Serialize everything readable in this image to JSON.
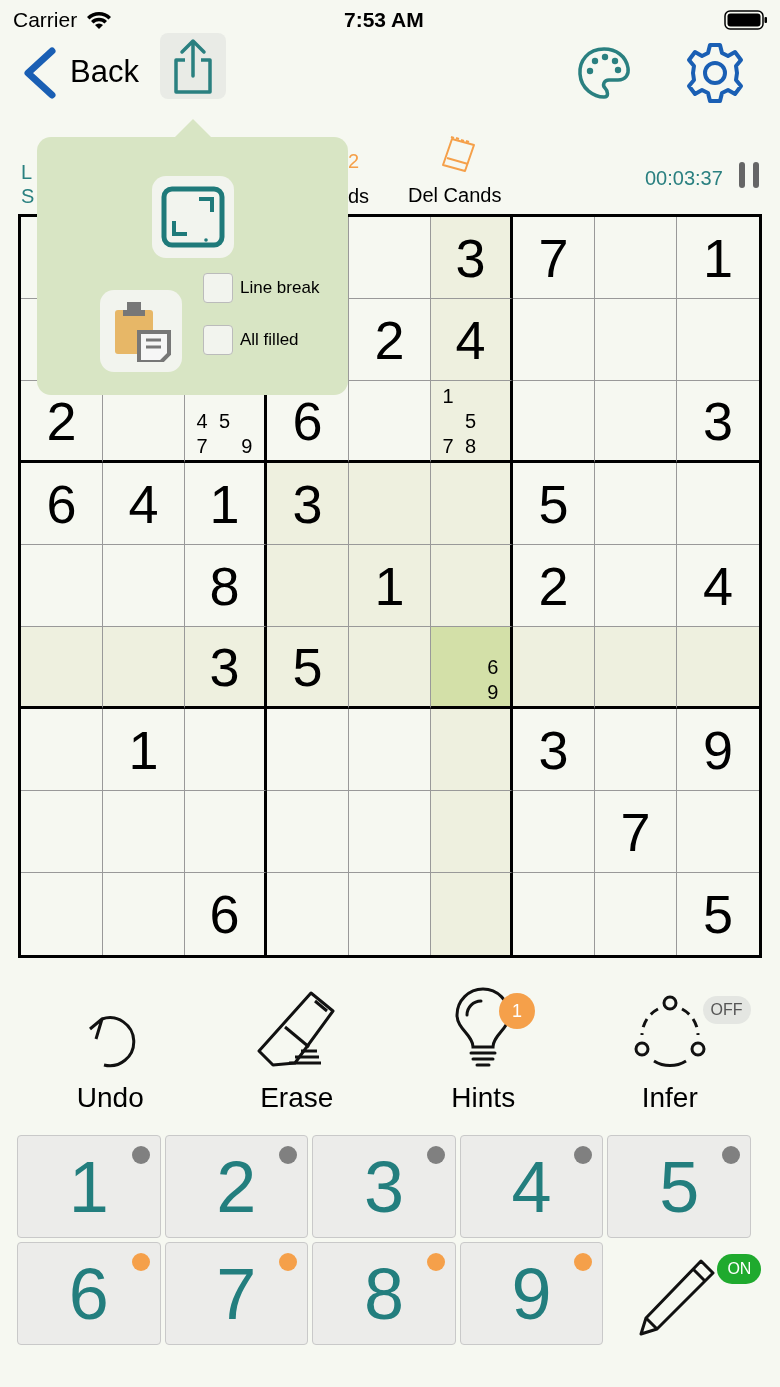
{
  "status_bar": {
    "carrier": "Carrier",
    "time": "7:53 AM"
  },
  "nav": {
    "back": "Back"
  },
  "info": {
    "level_partial": "L",
    "score_partial": "S",
    "count_partial": "2",
    "cands_partial": "ds",
    "del_cands": "Del Cands",
    "timer": "00:03:37"
  },
  "popover": {
    "options": [
      {
        "label": "Line break",
        "checked": false
      },
      {
        "label": "All filled",
        "checked": false
      }
    ]
  },
  "grid": {
    "rows": [
      [
        {
          "selected": false
        },
        null,
        null,
        null,
        {
          "selected": false
        },
        {
          "value": "3",
          "selected": false
        },
        {
          "value": "7",
          "selected": false
        },
        {
          "selected": false
        },
        {
          "value": "1",
          "selected": false
        }
      ],
      [
        {
          "selected": false
        },
        null,
        null,
        null,
        {
          "value": "2",
          "selected": false
        },
        {
          "value": "4",
          "selected": false
        },
        {
          "selected": false
        },
        {
          "selected": false
        },
        {
          "selected": false
        }
      ],
      [
        {
          "value": "2",
          "selected": false
        },
        {
          "selected": false
        },
        {
          "candidates": [
            "4",
            "5",
            "7",
            "9"
          ],
          "selected": false
        },
        {
          "value": "6",
          "selected": false
        },
        {
          "selected": false
        },
        {
          "candidates": [
            "1",
            "5",
            "7",
            "8"
          ],
          "selected": false
        },
        {
          "selected": false
        },
        {
          "selected": false
        },
        {
          "value": "3",
          "selected": false
        }
      ],
      [
        {
          "value": "6",
          "selected": false
        },
        {
          "value": "4",
          "selected": false
        },
        {
          "value": "1",
          "selected": false
        },
        {
          "value": "3",
          "selected": false
        },
        {
          "selected": false
        },
        {
          "selected": false
        },
        {
          "value": "5",
          "selected": false
        },
        {
          "selected": false
        },
        {
          "selected": false
        }
      ],
      [
        {
          "selected": false
        },
        {
          "selected": false
        },
        {
          "value": "8",
          "selected": false
        },
        {
          "selected": false
        },
        {
          "value": "1",
          "selected": false
        },
        {
          "selected": false
        },
        {
          "value": "2",
          "selected": false
        },
        {
          "selected": false
        },
        {
          "value": "4",
          "selected": false
        }
      ],
      [
        {
          "selected": false
        },
        {
          "selected": false
        },
        {
          "value": "3",
          "selected": false
        },
        {
          "value": "5",
          "selected": false
        },
        {
          "selected": false
        },
        {
          "candidates": [
            "6",
            "9"
          ],
          "selected": true
        },
        {
          "selected": false
        },
        {
          "selected": false
        },
        {
          "selected": false
        }
      ],
      [
        {
          "selected": false
        },
        {
          "value": "1",
          "selected": false
        },
        {
          "selected": false
        },
        {
          "selected": false
        },
        {
          "selected": false
        },
        {
          "selected": false
        },
        {
          "value": "3",
          "selected": false
        },
        {
          "selected": false
        },
        {
          "value": "9",
          "selected": false
        }
      ],
      [
        {
          "selected": false
        },
        {
          "selected": false
        },
        {
          "selected": false
        },
        {
          "selected": false
        },
        {
          "selected": false
        },
        {
          "selected": false
        },
        {
          "selected": false
        },
        {
          "value": "7",
          "selected": false
        },
        {
          "selected": false
        }
      ],
      [
        {
          "selected": false
        },
        {
          "selected": false
        },
        {
          "value": "6",
          "selected": false
        },
        {
          "selected": false
        },
        {
          "selected": false
        },
        {
          "selected": false
        },
        {
          "selected": false
        },
        {
          "selected": false
        },
        {
          "value": "5",
          "selected": false
        }
      ]
    ]
  },
  "tools": [
    {
      "kind": "undo",
      "label": "Undo"
    },
    {
      "kind": "erase",
      "label": "Erase"
    },
    {
      "kind": "hints",
      "label": "Hints",
      "badge": "1"
    },
    {
      "kind": "infer",
      "label": "Infer",
      "toggle": "OFF",
      "on": false
    }
  ],
  "number_pad": [
    {
      "digit": "1",
      "color": "#808080"
    },
    {
      "digit": "2",
      "color": "#808080"
    },
    {
      "digit": "3",
      "color": "#808080"
    },
    {
      "digit": "4",
      "color": "#808080"
    },
    {
      "digit": "5",
      "color": "#808080"
    },
    {
      "digit": "6",
      "color": "#f5a04a"
    },
    {
      "digit": "7",
      "color": "#f5a04a"
    },
    {
      "digit": "8",
      "color": "#f5a04a"
    },
    {
      "digit": "9",
      "color": "#f5a04a"
    }
  ],
  "pencil": {
    "toggle": "ON",
    "on": true
  }
}
